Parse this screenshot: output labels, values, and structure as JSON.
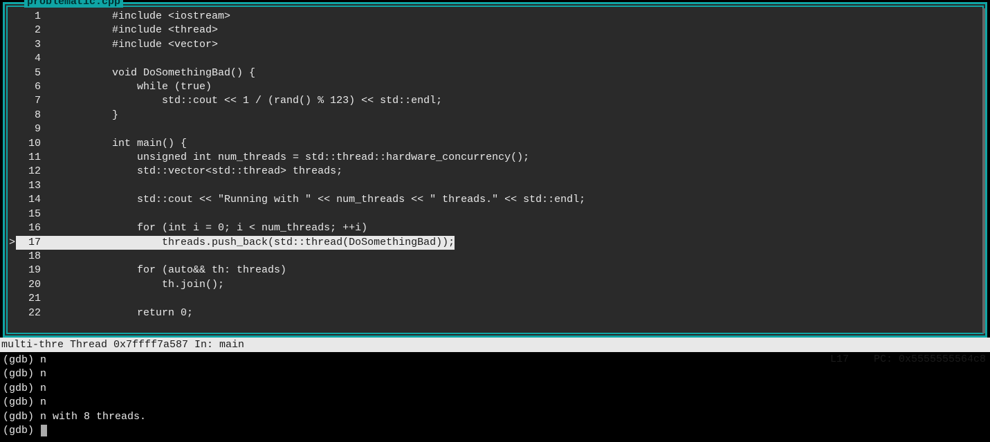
{
  "file_title": "problematic.cpp",
  "current_line_marker": ">",
  "highlighted_line": 17,
  "lines": [
    {
      "n": 1,
      "t": "           #include <iostream>"
    },
    {
      "n": 2,
      "t": "           #include <thread>"
    },
    {
      "n": 3,
      "t": "           #include <vector>"
    },
    {
      "n": 4,
      "t": ""
    },
    {
      "n": 5,
      "t": "           void DoSomethingBad() {"
    },
    {
      "n": 6,
      "t": "               while (true)"
    },
    {
      "n": 7,
      "t": "                   std::cout << 1 / (rand() % 123) << std::endl;"
    },
    {
      "n": 8,
      "t": "           }"
    },
    {
      "n": 9,
      "t": ""
    },
    {
      "n": 10,
      "t": "           int main() {"
    },
    {
      "n": 11,
      "t": "               unsigned int num_threads = std::thread::hardware_concurrency();"
    },
    {
      "n": 12,
      "t": "               std::vector<std::thread> threads;"
    },
    {
      "n": 13,
      "t": ""
    },
    {
      "n": 14,
      "t": "               std::cout << \"Running with \" << num_threads << \" threads.\" << std::endl;"
    },
    {
      "n": 15,
      "t": ""
    },
    {
      "n": 16,
      "t": "               for (int i = 0; i < num_threads; ++i)"
    },
    {
      "n": 17,
      "t": "                   threads.push_back(std::thread(DoSomethingBad));"
    },
    {
      "n": 18,
      "t": ""
    },
    {
      "n": 19,
      "t": "               for (auto&& th: threads)"
    },
    {
      "n": 20,
      "t": "                   th.join();"
    },
    {
      "n": 21,
      "t": ""
    },
    {
      "n": 22,
      "t": "               return 0;"
    }
  ],
  "status": {
    "left": "multi-thre Thread 0x7ffff7a587 In: main",
    "line_label": "L17",
    "pc_label": "PC: 0x5555555564c8"
  },
  "console_lines": [
    "(gdb) n",
    "(gdb) n",
    "(gdb) n",
    "(gdb) n",
    "(gdb) n with 8 threads.",
    "(gdb) "
  ]
}
